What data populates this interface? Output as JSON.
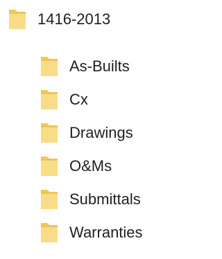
{
  "tree": {
    "root": {
      "label": "1416-2013",
      "icon": "folder-icon"
    },
    "children": [
      {
        "label": "As-Builts",
        "icon": "folder-icon"
      },
      {
        "label": "Cx",
        "icon": "folder-icon"
      },
      {
        "label": "Drawings",
        "icon": "folder-icon"
      },
      {
        "label": "O&Ms",
        "icon": "folder-icon"
      },
      {
        "label": "Submittals",
        "icon": "folder-icon"
      },
      {
        "label": "Warranties",
        "icon": "folder-icon"
      }
    ]
  },
  "colors": {
    "folder_back": "#f2c65a",
    "folder_front": "#f8dc88",
    "folder_edge": "#e5b541",
    "text": "#1f1f1f",
    "background": "#ffffff"
  }
}
